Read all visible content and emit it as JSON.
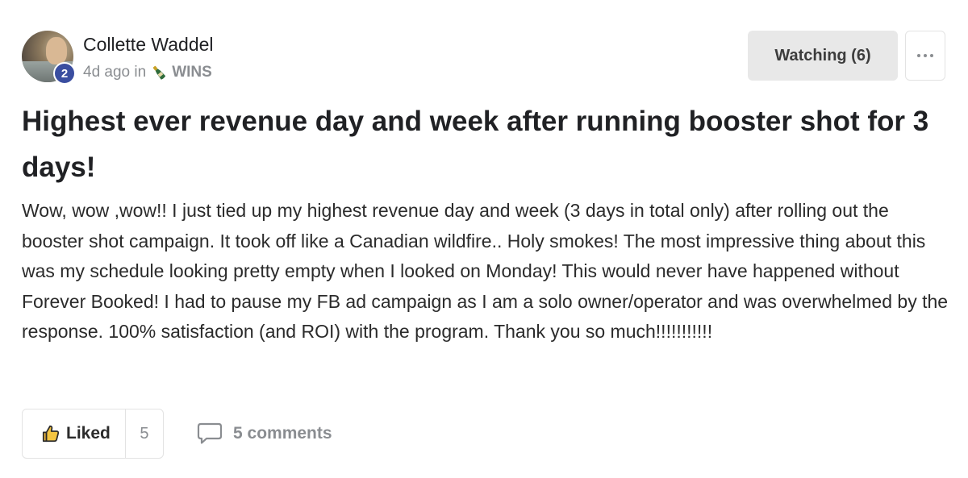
{
  "author": {
    "name": "Collette Waddel",
    "level": "2"
  },
  "meta": {
    "time": "4d ago in",
    "category": "WINS",
    "category_icon": "champagne-bottle-icon"
  },
  "actions": {
    "watch_label": "Watching (6)",
    "more_icon": "more-horizontal-icon"
  },
  "post": {
    "title": "Highest ever revenue day and week after running booster shot for 3 days!",
    "body": "Wow, wow ,wow!! I just tied up my highest revenue day and week (3 days in total only) after rolling out the booster shot campaign. It took off like a Canadian wildfire.. Holy smokes! The most impressive thing about this was my schedule looking pretty empty when I looked on Monday! This would never have happened without Forever Booked! I had to pause my FB ad campaign as I am a solo owner/operator and was overwhelmed by the response. 100% satisfaction (and ROI) with the program. Thank you so much!!!!!!!!!!!"
  },
  "footer": {
    "like_label": "Liked",
    "like_count": "5",
    "comments_label": "5 comments"
  },
  "colors": {
    "badge": "#3a4ea0",
    "muted_text": "#8a8d91",
    "watch_button_bg": "#e8e8e8"
  }
}
